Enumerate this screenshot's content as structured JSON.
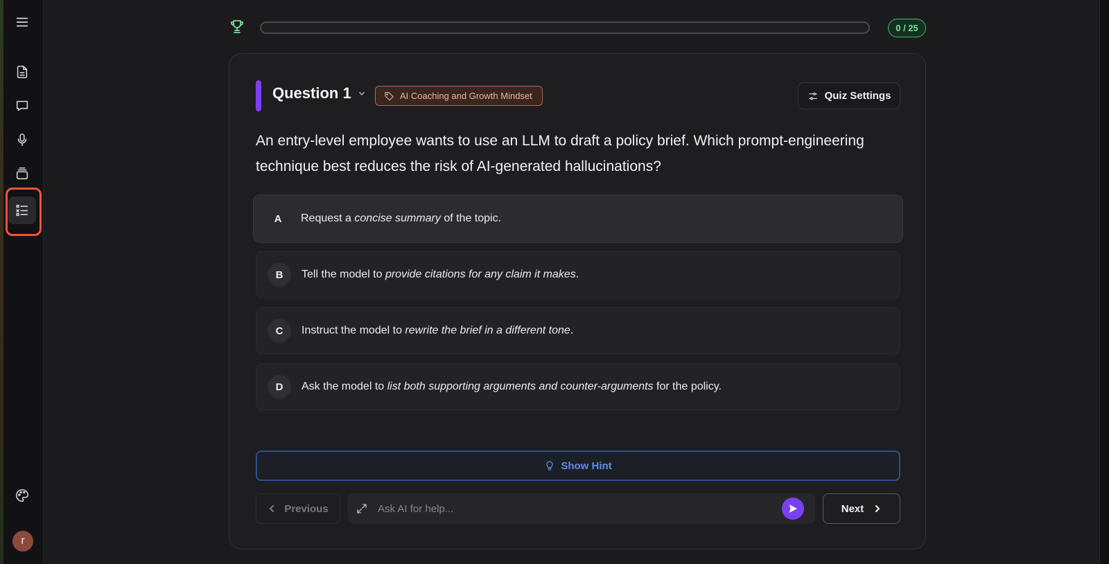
{
  "progress": {
    "current": 0,
    "total": 25,
    "label": "0 / 25",
    "fraction": 0
  },
  "question": {
    "title": "Question 1",
    "tag": "AI Coaching and Growth Mindset",
    "text": "An entry-level employee wants to use an LLM to draft a policy brief. Which prompt-engineering technique best reduces the risk of AI-generated hallucinations?"
  },
  "quiz_settings_label": "Quiz Settings",
  "options": [
    {
      "letter": "A",
      "before": "Request a ",
      "emph": "concise summary",
      "after": " of the topic."
    },
    {
      "letter": "B",
      "before": "Tell the model to ",
      "emph": "provide citations for any claim it makes",
      "after": "."
    },
    {
      "letter": "C",
      "before": "Instruct the model to ",
      "emph": "rewrite the brief in a different tone",
      "after": "."
    },
    {
      "letter": "D",
      "before": "Ask the model to ",
      "emph": "list both supporting arguments and counter-arguments",
      "after": " for the policy."
    }
  ],
  "hint_label": "Show Hint",
  "previous_label": "Previous",
  "next_label": "Next",
  "ask": {
    "placeholder": "Ask AI for help...",
    "value": ""
  },
  "avatar_initial": "r",
  "colors": {
    "accent_purple": "#7b3ff2",
    "success_green": "#7ddf9d",
    "hint_blue": "#5b8fe8",
    "tag_orange": "#f0b29b",
    "highlight_red": "#f2553a"
  }
}
